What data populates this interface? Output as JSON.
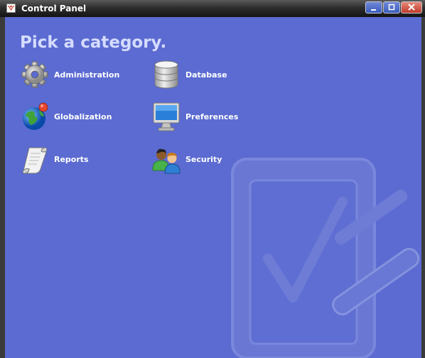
{
  "window": {
    "title": "Control Panel"
  },
  "page": {
    "heading": "Pick a category."
  },
  "categories": [
    {
      "label": "Administration",
      "icon": "gear-icon"
    },
    {
      "label": "Database",
      "icon": "database-icon"
    },
    {
      "label": "Globalization",
      "icon": "globe-icon"
    },
    {
      "label": "Preferences",
      "icon": "monitor-icon"
    },
    {
      "label": "Reports",
      "icon": "scroll-icon"
    },
    {
      "label": "Security",
      "icon": "users-icon"
    }
  ],
  "colors": {
    "background": "#5b6bd1",
    "heading": "#d6dcff",
    "title_bar": "#2e2e2e"
  }
}
